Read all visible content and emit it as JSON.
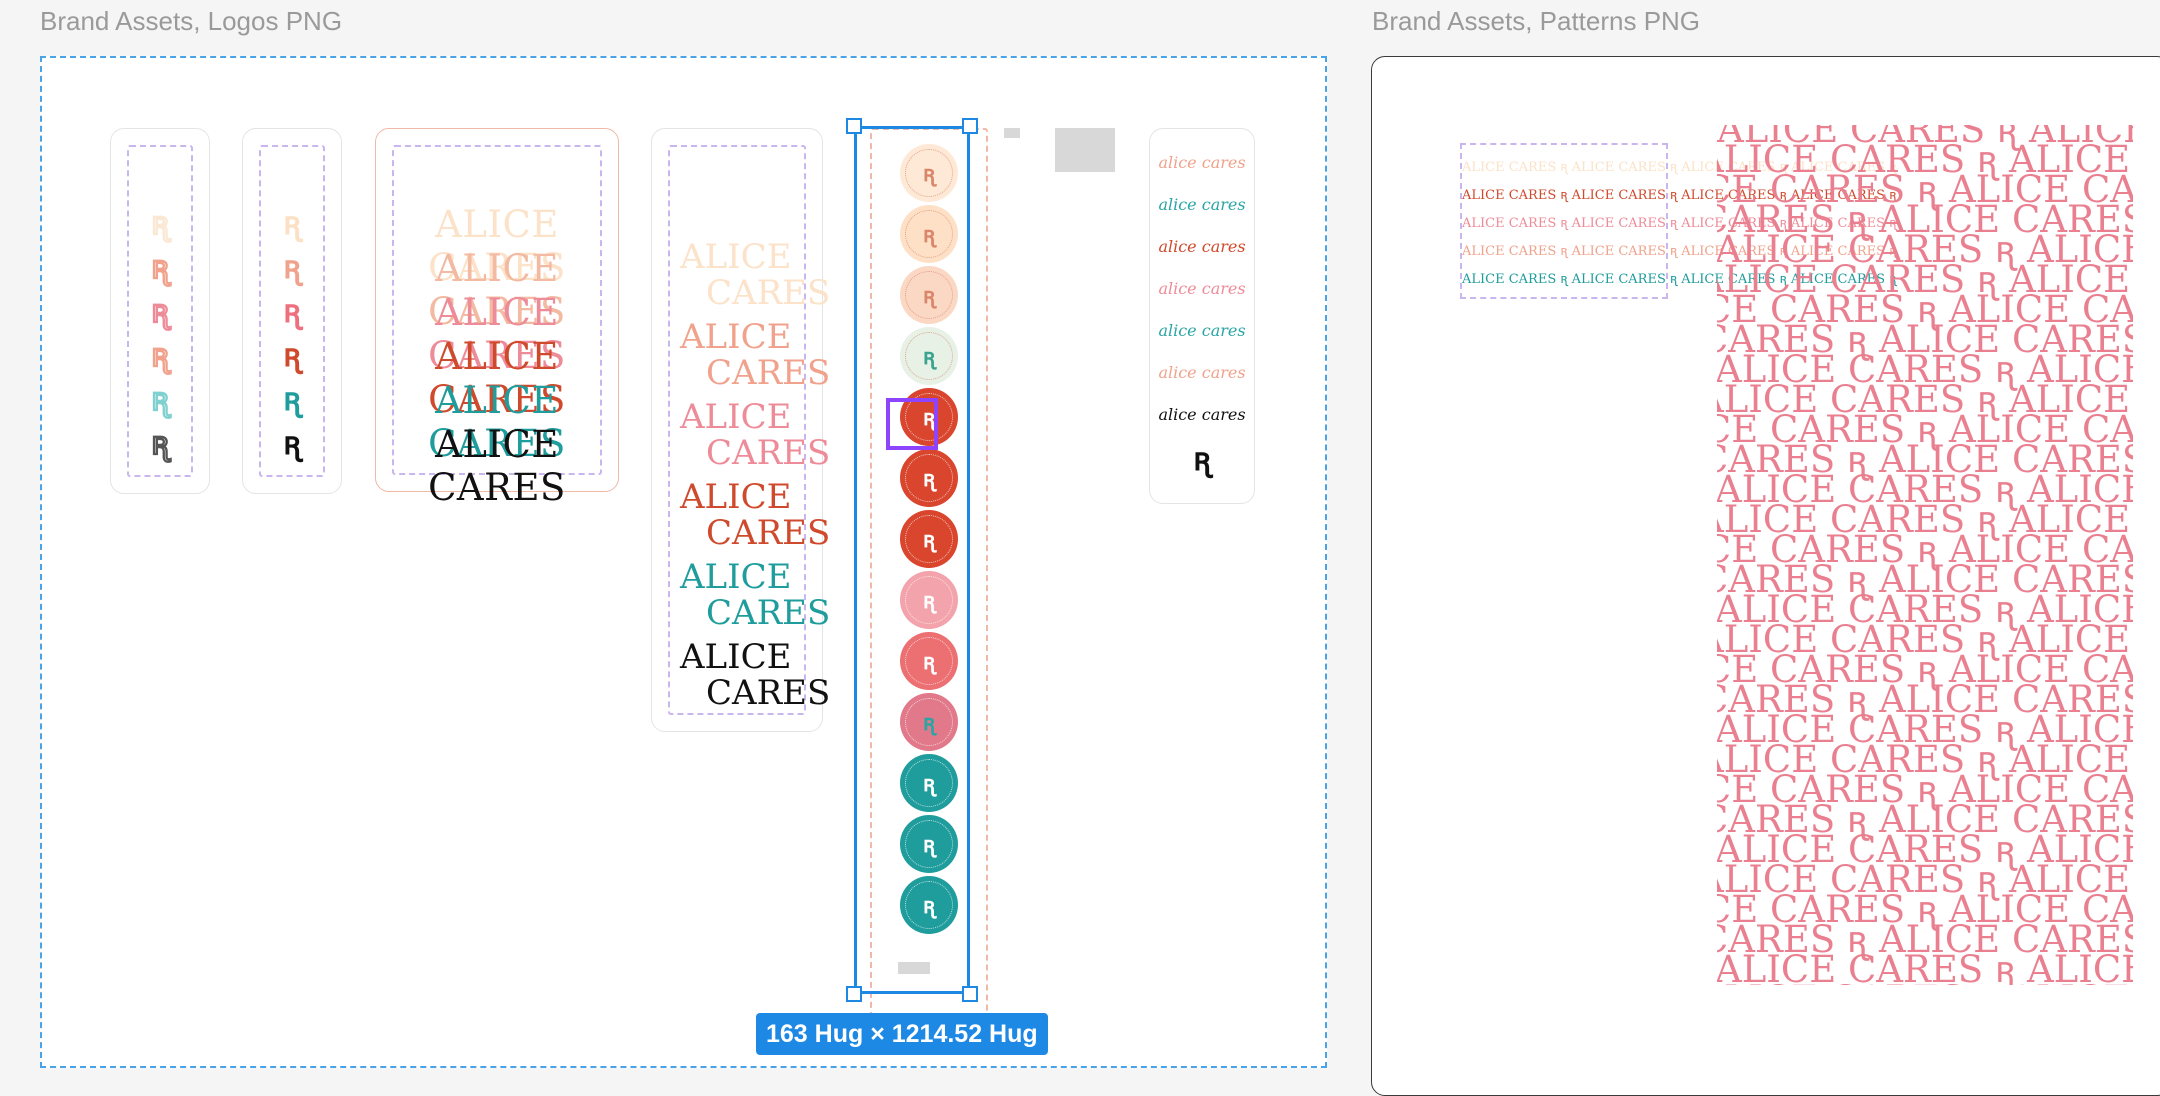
{
  "frames": {
    "logos_title": "Brand Assets, Logos PNG",
    "patterns_title": "Brand Assets, Patterns PNG"
  },
  "brand": {
    "monogram": "ꭆ",
    "wordmark": "ALICE CARES",
    "wordmark_line1": "ALICE",
    "wordmark_line2": "CARES",
    "script_name": "alice cares",
    "pattern_text": "ALICE CARES ꭆ ALICE CARES ꭆ ALICE CARES ꭆ ALICE CARES ꭆ"
  },
  "selection": {
    "size_label": "163 Hug × 1214.52 Hug"
  },
  "colors": {
    "cream": "#fbe8d3",
    "peach": "#f7c8b2",
    "salmon": "#f0a28c",
    "coral": "#cf4a2c",
    "pink": "#ee8b98",
    "teal": "#2aa5a5",
    "black": "#111111",
    "selection_blue": "#1e88e5",
    "dash_purple": "#c9b6ee",
    "badge_highlight": "#8e44ff"
  }
}
